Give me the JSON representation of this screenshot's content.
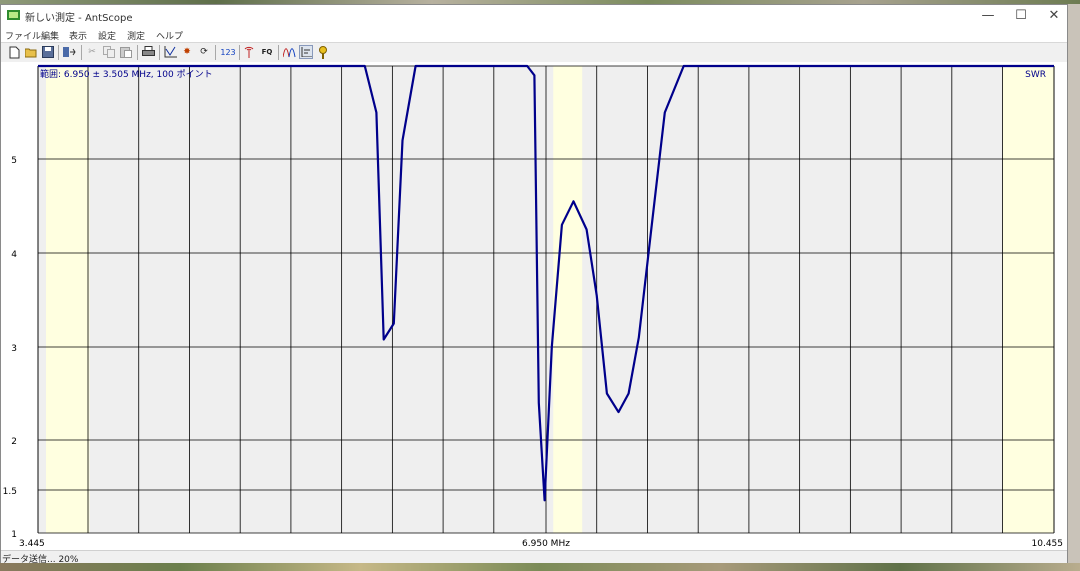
{
  "window": {
    "title": "新しい測定 - AntScope",
    "minimize": "—",
    "maximize": "☐",
    "close": "✕"
  },
  "menu": [
    "ファイル",
    "編集",
    "表示",
    "設定",
    "測定",
    "ヘルプ"
  ],
  "toolbar": {
    "icons": [
      "new-icon",
      "open-icon",
      "save-icon",
      "export-icon",
      "cut-icon",
      "copy-icon",
      "paste-icon",
      "print-icon",
      "chart-icon",
      "star-icon",
      "refresh-icon",
      "numbers-icon",
      "antenna-icon",
      "fq-icon",
      "curves-icon",
      "bars-icon",
      "help-icon"
    ],
    "labels": {
      "numbers": "123",
      "fq": "FQ"
    }
  },
  "chart_data": {
    "type": "line",
    "info": "範囲: 6.950 ± 3.505 MHz, 100 ポイント",
    "ylabel": "SWR",
    "xlim": [
      3.445,
      10.455
    ],
    "ylim": [
      1,
      6
    ],
    "x_ticks": [
      {
        "value": 3.445,
        "label": "3.445"
      },
      {
        "value": 6.95,
        "label": "6.950 MHz"
      },
      {
        "value": 10.455,
        "label": "10.455"
      }
    ],
    "y_ticks": [
      {
        "value": 1,
        "label": "1"
      },
      {
        "value": 1.5,
        "label": "1.5"
      },
      {
        "value": 2,
        "label": "2"
      },
      {
        "value": 3,
        "label": "3"
      },
      {
        "value": 4,
        "label": "4"
      },
      {
        "value": 5,
        "label": "5"
      }
    ],
    "x_gridlines": [
      3.445,
      3.79,
      4.14,
      4.49,
      4.84,
      5.19,
      5.54,
      5.89,
      6.24,
      6.59,
      6.95,
      7.3,
      7.65,
      8.0,
      8.35,
      8.7,
      9.05,
      9.4,
      9.75,
      10.1,
      10.455
    ],
    "bands": [
      [
        3.5,
        3.8
      ],
      [
        7.0,
        7.2
      ],
      [
        10.1,
        10.455
      ]
    ],
    "colors": {
      "line": "#00008b",
      "band": "#ffffe0",
      "plot_bg": "#efefef",
      "grid": "#000000",
      "info_text": "#00008b"
    },
    "series": [
      {
        "x": [
          3.445,
          5.7,
          5.78,
          5.83,
          5.9,
          5.96,
          6.05,
          6.82,
          6.87,
          6.9,
          6.94,
          6.99,
          7.06,
          7.14,
          7.23,
          7.3,
          7.37,
          7.45,
          7.52,
          7.59,
          7.68,
          7.77,
          7.9,
          10.455
        ],
        "values": [
          6.0,
          6.0,
          5.5,
          3.08,
          3.25,
          5.2,
          6.0,
          6.0,
          5.9,
          2.4,
          1.38,
          3.0,
          4.3,
          4.55,
          4.25,
          3.55,
          2.5,
          2.3,
          2.5,
          3.1,
          4.3,
          5.5,
          6.0,
          6.0
        ]
      }
    ]
  },
  "status": "データ送信... 20%"
}
